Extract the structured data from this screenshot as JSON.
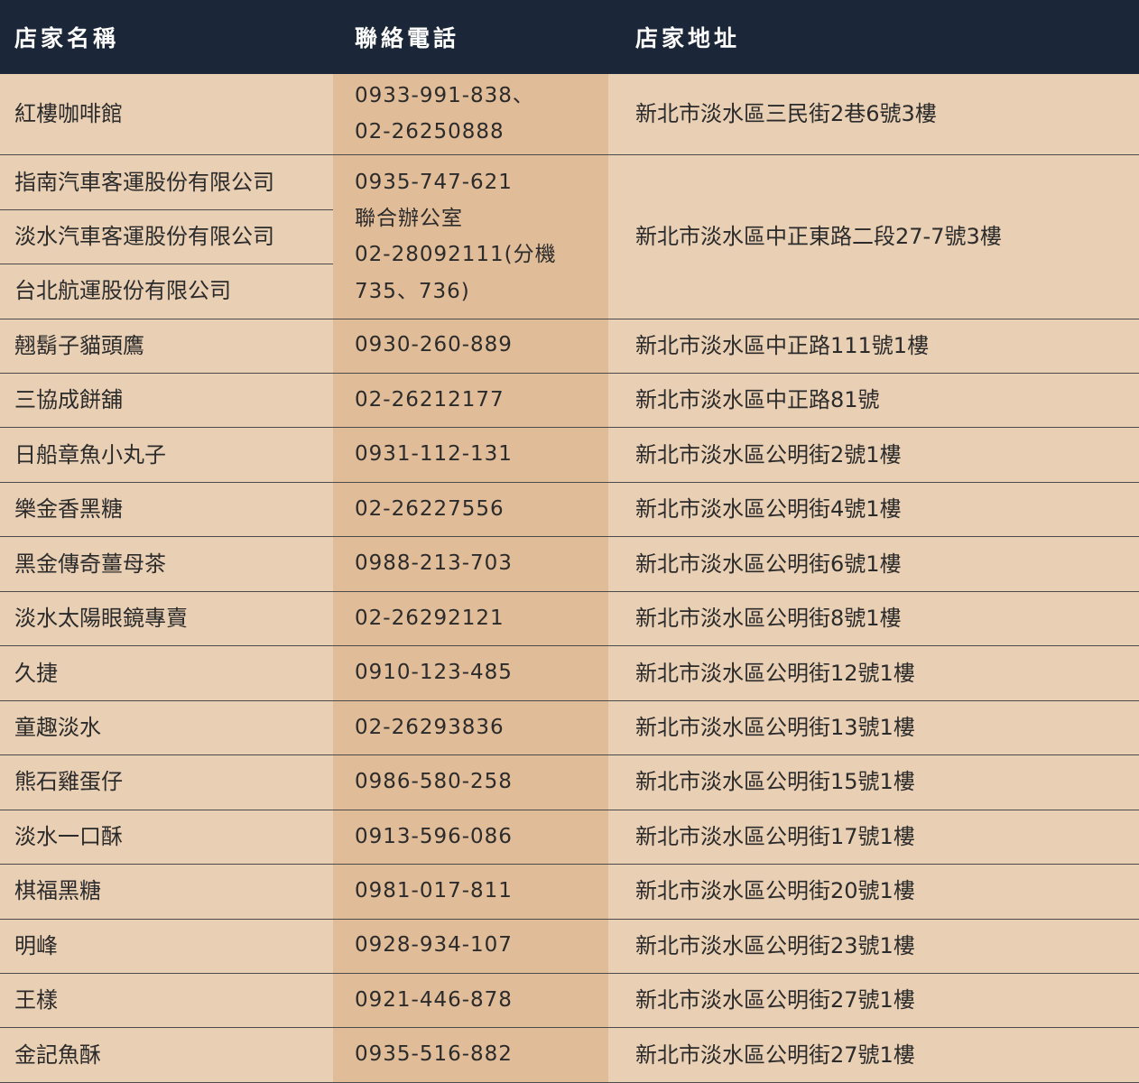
{
  "header": {
    "name_label": "店家名稱",
    "phone_label": "聯絡電話",
    "address_label": "店家地址"
  },
  "rows": [
    {
      "name": "紅樓咖啡館",
      "phone_lines": [
        "0933-991-838、",
        "02-26250888"
      ],
      "address": "新北市淡水區三民街2巷6號3樓"
    },
    {
      "name": "指南汽車客運股份有限公司"
    },
    {
      "name": "淡水汽車客運股份有限公司"
    },
    {
      "name": "台北航運股份有限公司"
    },
    {
      "name": "翹鬍子貓頭鷹",
      "phone": "0930-260-889",
      "address": "新北市淡水區中正路111號1樓"
    },
    {
      "name": "三協成餅舖",
      "phone": "02-26212177",
      "address": "新北市淡水區中正路81號"
    },
    {
      "name": "日船章魚小丸子",
      "phone": "0931-112-131",
      "address": "新北市淡水區公明街2號1樓"
    },
    {
      "name": "樂金香黑糖",
      "phone": "02-26227556",
      "address": "新北市淡水區公明街4號1樓"
    },
    {
      "name": "黑金傳奇薑母茶",
      "phone": "0988-213-703",
      "address": "新北市淡水區公明街6號1樓"
    },
    {
      "name": "淡水太陽眼鏡專賣",
      "phone": "02-26292121",
      "address": "新北市淡水區公明街8號1樓"
    },
    {
      "name": "久捷",
      "phone": "0910-123-485",
      "address": "新北市淡水區公明街12號1樓"
    },
    {
      "name": "童趣淡水",
      "phone": "02-26293836",
      "address": "新北市淡水區公明街13號1樓"
    },
    {
      "name": "熊石雞蛋仔",
      "phone": "0986-580-258",
      "address": "新北市淡水區公明街15號1樓"
    },
    {
      "name": "淡水一口酥",
      "phone": "0913-596-086",
      "address": "新北市淡水區公明街17號1樓"
    },
    {
      "name": "棋福黑糖",
      "phone": "0981-017-811",
      "address": "新北市淡水區公明街20號1樓"
    },
    {
      "name": "明峰",
      "phone": "0928-934-107",
      "address": "新北市淡水區公明街23號1樓"
    },
    {
      "name": "王樣",
      "phone": "0921-446-878",
      "address": "新北市淡水區公明街27號1樓"
    },
    {
      "name": "金記魚酥",
      "phone": "0935-516-882",
      "address": "新北市淡水區公明街27號1樓"
    }
  ],
  "shared_group": {
    "phone_lines": [
      "0935-747-621",
      "聯合辦公室",
      "02-28092111(分機",
      "735、736)"
    ],
    "address": "新北市淡水區中正東路二段27-7號3樓"
  },
  "colors": {
    "header_bg": "#1b2738",
    "row_bg": "#e9cfb4",
    "phone_col_bg": "#e1bc99",
    "divider": "#4b4b4b"
  }
}
